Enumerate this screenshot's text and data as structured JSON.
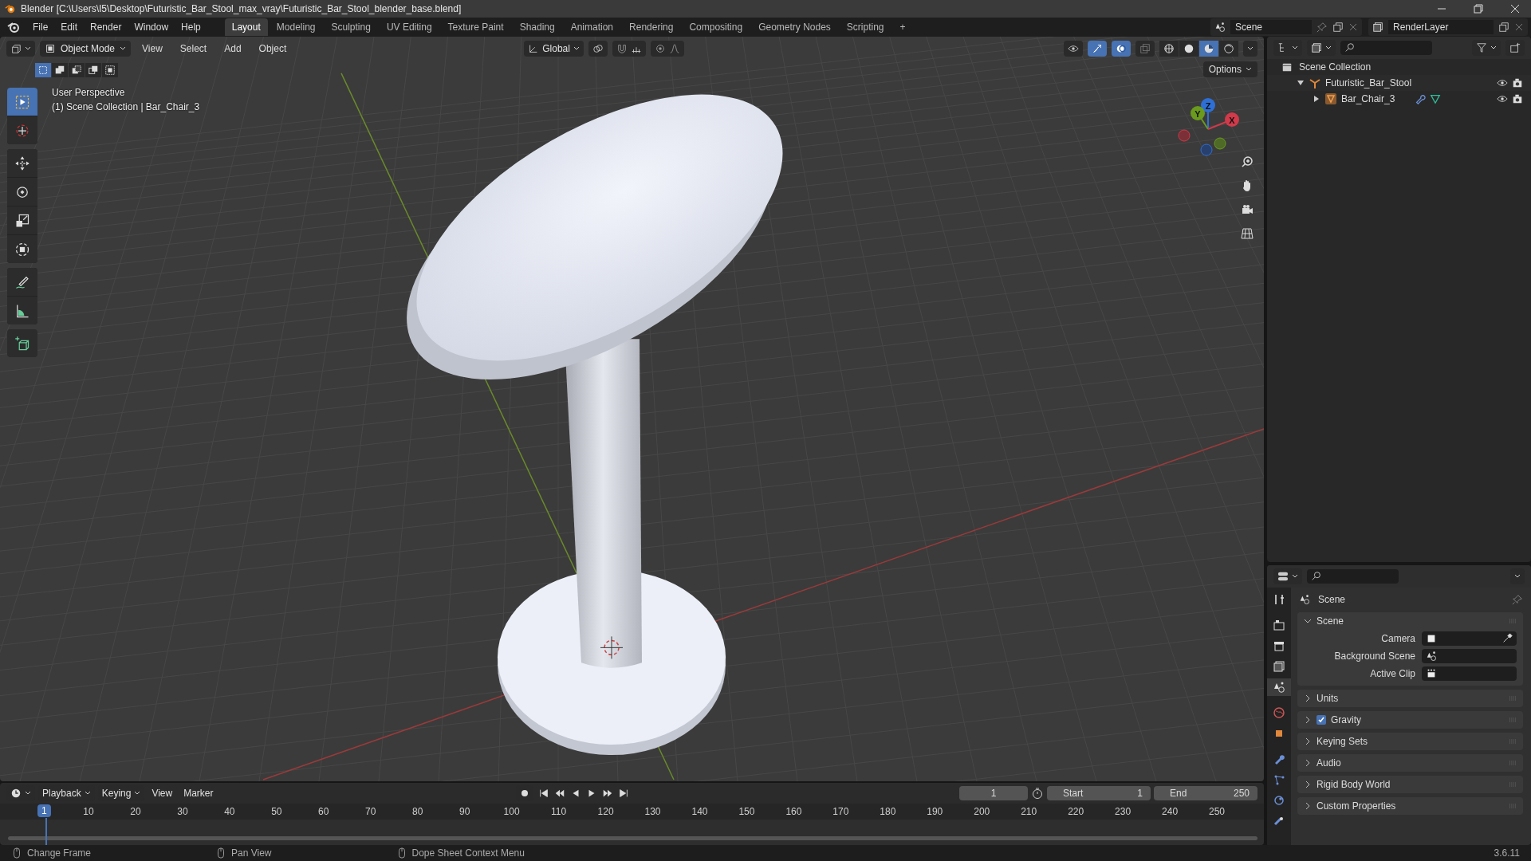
{
  "window": {
    "title": "Blender [C:\\Users\\I5\\Desktop\\Futuristic_Bar_Stool_max_vray\\Futuristic_Bar_Stool_blender_base.blend]"
  },
  "menu": [
    "File",
    "Edit",
    "Render",
    "Window",
    "Help"
  ],
  "workspaces": [
    {
      "label": "Layout",
      "selected": true
    },
    {
      "label": "Modeling",
      "selected": false
    },
    {
      "label": "Sculpting",
      "selected": false
    },
    {
      "label": "UV Editing",
      "selected": false
    },
    {
      "label": "Texture Paint",
      "selected": false
    },
    {
      "label": "Shading",
      "selected": false
    },
    {
      "label": "Animation",
      "selected": false
    },
    {
      "label": "Rendering",
      "selected": false
    },
    {
      "label": "Compositing",
      "selected": false
    },
    {
      "label": "Geometry Nodes",
      "selected": false
    },
    {
      "label": "Scripting",
      "selected": false
    }
  ],
  "add_workspace": "+",
  "scene_selector": {
    "value": "Scene"
  },
  "view_layer": {
    "value": "RenderLayer"
  },
  "viewport": {
    "mode": "Object Mode",
    "menus": [
      "View",
      "Select",
      "Add",
      "Object"
    ],
    "orientation": "Global",
    "options": "Options",
    "view_name": "User Perspective",
    "view_info": "(1) Scene Collection | Bar_Chair_3",
    "select_modes": [
      {
        "kind": "new",
        "selected": true
      },
      {
        "kind": "extend",
        "selected": false
      },
      {
        "kind": "subtract",
        "selected": false
      },
      {
        "kind": "invert",
        "selected": false
      },
      {
        "kind": "intersect",
        "selected": false
      }
    ],
    "tools": [
      {
        "kind": "select",
        "selected": true
      },
      {
        "kind": "cursor",
        "selected": false
      },
      {
        "kind": "move",
        "selected": false
      },
      {
        "kind": "rotate",
        "selected": false
      },
      {
        "kind": "scale",
        "selected": false
      },
      {
        "kind": "transform",
        "selected": false
      },
      {
        "kind": "annotate",
        "selected": false
      },
      {
        "kind": "measure",
        "selected": false
      },
      {
        "kind": "add_cube",
        "selected": false
      }
    ],
    "shading": [
      {
        "kind": "wireframe",
        "selected": false
      },
      {
        "kind": "solid",
        "selected": false
      },
      {
        "kind": "material",
        "selected": true
      },
      {
        "kind": "rendered",
        "selected": false
      }
    ],
    "gizmo_axes": [
      "Z",
      "Y",
      "X"
    ]
  },
  "outliner": {
    "root": "Scene Collection",
    "items": [
      {
        "label": "Futuristic_Bar_Stool",
        "kind": "empty",
        "expanded": true,
        "children": [
          {
            "label": "Bar_Chair_3",
            "kind": "mesh",
            "expanded": false
          }
        ]
      }
    ]
  },
  "properties": {
    "tabs": [
      {
        "kind": "tool",
        "selected": false
      },
      {
        "kind": "render",
        "selected": false
      },
      {
        "kind": "output",
        "selected": false
      },
      {
        "kind": "view_layer",
        "selected": false
      },
      {
        "kind": "scene",
        "selected": true
      },
      {
        "kind": "world",
        "selected": false
      },
      {
        "kind": "object",
        "selected": false
      },
      {
        "kind": "modifier",
        "selected": false
      },
      {
        "kind": "particles",
        "selected": false
      },
      {
        "kind": "physics",
        "selected": false
      },
      {
        "kind": "constraints",
        "selected": false
      }
    ],
    "context": "Scene",
    "panels": [
      {
        "title": "Scene",
        "kind": "plain",
        "expanded": true,
        "fields": [
          {
            "label": "Camera",
            "kind": "camera"
          },
          {
            "label": "Background Scene",
            "kind": "scene"
          },
          {
            "label": "Active Clip",
            "kind": "clip"
          }
        ]
      },
      {
        "title": "Units",
        "kind": "plain",
        "expanded": false
      },
      {
        "title": "Gravity",
        "kind": "checkbox",
        "checked": true,
        "expanded": false
      },
      {
        "title": "Keying Sets",
        "kind": "plain",
        "expanded": false
      },
      {
        "title": "Audio",
        "kind": "plain",
        "expanded": false
      },
      {
        "title": "Rigid Body World",
        "kind": "plain",
        "expanded": false
      },
      {
        "title": "Custom Properties",
        "kind": "plain",
        "expanded": false
      }
    ]
  },
  "timeline": {
    "menus": [
      "Playback",
      "Keying",
      "View",
      "Marker"
    ],
    "current_frame": "1",
    "start_label": "Start",
    "start": "1",
    "end_label": "End",
    "end": "250",
    "playhead": "1",
    "ticks": [
      "10",
      "20",
      "30",
      "40",
      "50",
      "60",
      "70",
      "80",
      "90",
      "100",
      "110",
      "120",
      "130",
      "140",
      "150",
      "160",
      "170",
      "180",
      "190",
      "200",
      "210",
      "220",
      "230",
      "240",
      "250"
    ]
  },
  "status_bar": {
    "hints": [
      "Change Frame",
      "Pan View",
      "Dope Sheet Context Menu"
    ],
    "version": "3.6.11"
  }
}
